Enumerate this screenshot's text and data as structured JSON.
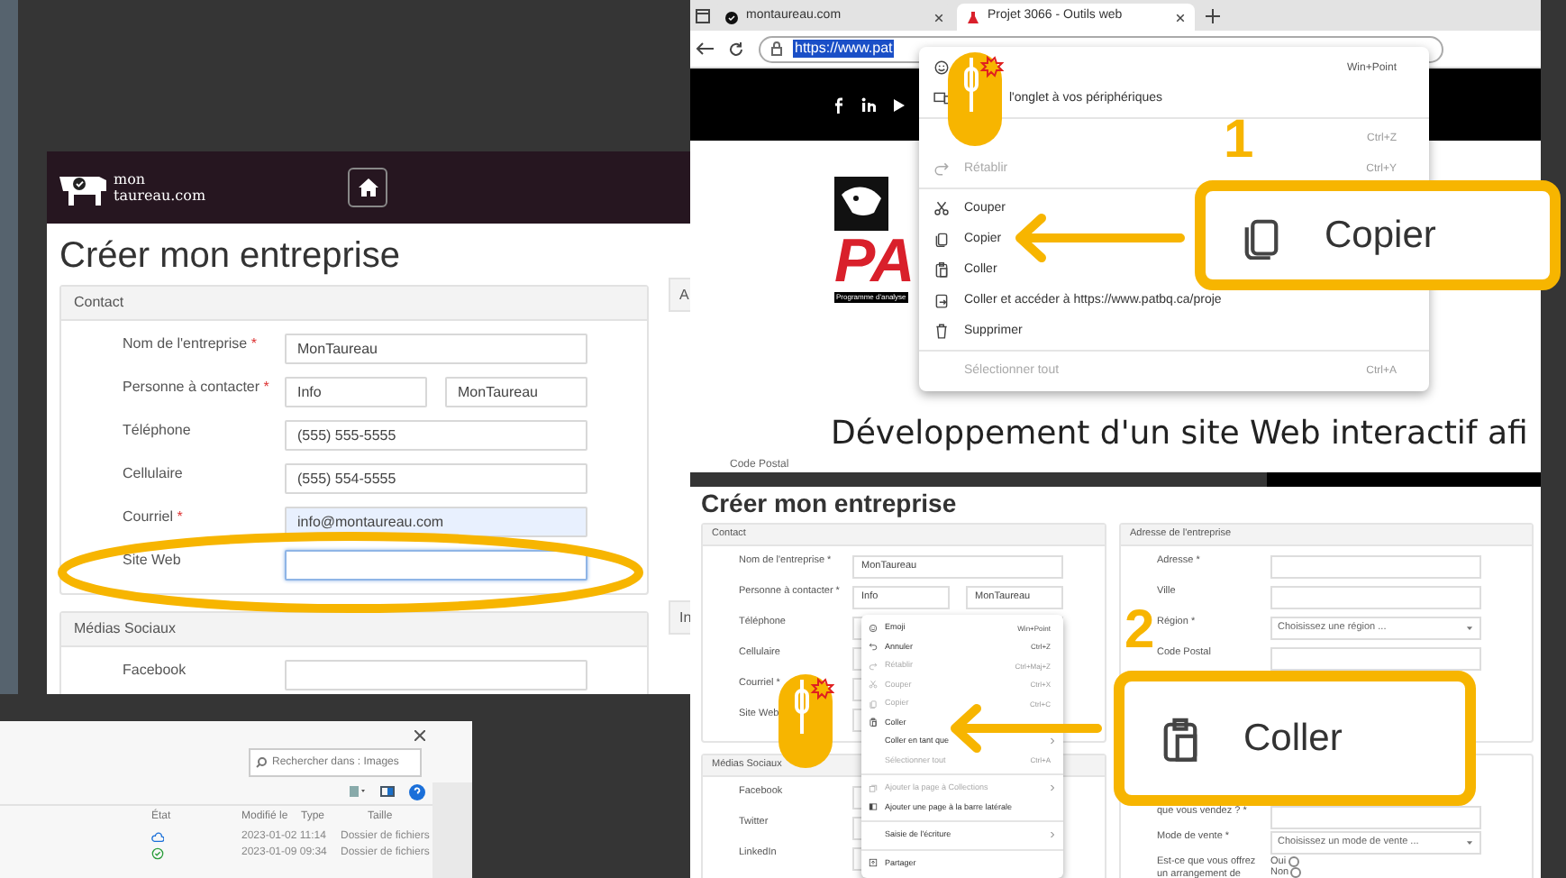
{
  "form_window": {
    "logo_text": [
      "mon",
      "taureau.com"
    ],
    "heading": "Créer mon entreprise",
    "sections": [
      {
        "title": "Contact",
        "fields": [
          {
            "label": "Nom de l'entreprise",
            "required_mark": "*",
            "values": [
              "MonTaureau"
            ],
            "autofilled": false,
            "focused": false
          },
          {
            "label": "Personne à contacter",
            "required_mark": "*",
            "values": [
              "Info",
              "MonTaureau"
            ],
            "autofilled": false,
            "focused": false
          },
          {
            "label": "Téléphone",
            "values": [
              "(555) 555-5555"
            ],
            "autofilled": false,
            "focused": false
          },
          {
            "label": "Cellulaire",
            "values": [
              "(555) 554-5555"
            ],
            "autofilled": false,
            "focused": false
          },
          {
            "label": "Courriel",
            "required_mark": "*",
            "values": [
              "info@montaureau.com"
            ],
            "autofilled": true,
            "focused": false
          },
          {
            "label": "Site Web",
            "autofilled": false,
            "focused": true
          }
        ]
      },
      {
        "title": "Médias Sociaux",
        "fields": [
          {
            "label": "Facebook",
            "autofilled": false,
            "focused": false
          }
        ]
      }
    ],
    "side_sections": [
      {
        "title": "A"
      },
      {
        "title": "In"
      }
    ]
  },
  "browser_window": {
    "tabs": [
      {
        "title": "montaureau.com",
        "selected": false
      },
      {
        "title": "Projet 3066 - Outils web",
        "selected": true
      }
    ],
    "url_selected": "https://www.pat",
    "logo_letters": "PA",
    "logo_caption": "Programme d'analyse",
    "page_heading": "Développement d'un site Web interactif afi",
    "background_label": "Code Postal",
    "context_menu": [
      {
        "kind": "emoji",
        "shortcut": "Win+Point",
        "disabled": false
      },
      {
        "kind": "devices",
        "label": "l'onglet à vos périphériques",
        "disabled": false
      },
      {
        "kind": "separator"
      },
      {
        "kind": "plain",
        "shortcut": "Ctrl+Z",
        "disabled": true
      },
      {
        "kind": "redo",
        "label": "Rétablir",
        "shortcut": "Ctrl+Y",
        "disabled": true
      },
      {
        "kind": "separator"
      },
      {
        "kind": "cut",
        "label": "Couper",
        "disabled": false
      },
      {
        "kind": "copy",
        "label": "Copier",
        "disabled": false
      },
      {
        "kind": "paste",
        "label": "Coller",
        "disabled": false
      },
      {
        "kind": "paste-go",
        "label": "Coller et accéder à https://www.patbq.ca/proje",
        "disabled": false
      },
      {
        "kind": "trash",
        "label": "Supprimer",
        "disabled": false
      },
      {
        "kind": "separator"
      },
      {
        "kind": "plain",
        "label": "Sélectionner tout",
        "shortcut": "Ctrl+A",
        "disabled": true
      }
    ]
  },
  "form_window_2": {
    "heading": "Créer mon entreprise",
    "left_sections": [
      {
        "title": "Contact",
        "fields": [
          {
            "label": "Nom de l'entreprise *",
            "values": [
              "MonTaureau"
            ]
          },
          {
            "label": "Personne à contacter *",
            "values": [
              "Info",
              "MonTaureau"
            ]
          },
          {
            "label": "Téléphone"
          },
          {
            "label": "Cellulaire"
          },
          {
            "label": "Courriel *"
          },
          {
            "label": "Site Web"
          }
        ]
      },
      {
        "title": "Médias Sociaux",
        "fields": [
          {
            "label": "Facebook"
          },
          {
            "label": "Twitter"
          },
          {
            "label": "LinkedIn"
          }
        ]
      }
    ],
    "right_sections": [
      {
        "title": "Adresse de l'entreprise",
        "fields": [
          {
            "label": "Adresse *"
          },
          {
            "label": "Ville"
          },
          {
            "label": "Région *",
            "kind": "select",
            "placeholder": "Choisissez une région ..."
          },
          {
            "label": "Code Postal"
          }
        ]
      },
      {
        "fields": [
          {
            "label": "que vous vendez ? *"
          },
          {
            "label": "Mode de vente *",
            "kind": "select",
            "placeholder": "Choisissez un mode de vente ..."
          },
          {
            "label": "Est-ce que vous offrez un arrangement de",
            "kind": "radio",
            "options": [
              {
                "label": "Oui",
                "selected": false
              },
              {
                "label": "Non",
                "selected": false
              }
            ]
          }
        ]
      }
    ],
    "context_menu": [
      {
        "kind": "emoji",
        "label": "Emoji",
        "shortcut": "Win+Point",
        "disabled": false
      },
      {
        "kind": "undo",
        "label": "Annuler",
        "shortcut": "Ctrl+Z",
        "disabled": false
      },
      {
        "kind": "redo",
        "label": "Rétablir",
        "shortcut": "Ctrl+Maj+Z",
        "disabled": true
      },
      {
        "kind": "cut",
        "label": "Couper",
        "shortcut": "Ctrl+X",
        "disabled": true
      },
      {
        "kind": "copy",
        "label": "Copier",
        "shortcut": "Ctrl+C",
        "disabled": true
      },
      {
        "kind": "paste",
        "label": "Coller",
        "disabled": false
      },
      {
        "kind": "plain",
        "label": "Coller en tant que",
        "submenu": true,
        "disabled": false
      },
      {
        "kind": "plain",
        "label": "Sélectionner tout",
        "shortcut": "Ctrl+A",
        "disabled": true
      },
      {
        "kind": "separator"
      },
      {
        "kind": "collections",
        "label": "Ajouter la page à Collections",
        "submenu": true,
        "disabled": true
      },
      {
        "kind": "sidebar",
        "label": "Ajouter une page à la barre latérale",
        "disabled": false
      },
      {
        "kind": "separator"
      },
      {
        "kind": "plain",
        "label": "Saisie de l'écriture",
        "submenu": true,
        "disabled": false
      },
      {
        "kind": "separator"
      },
      {
        "kind": "share",
        "label": "Partager",
        "disabled": false
      }
    ]
  },
  "file_explorer": {
    "search_placeholder": "Rechercher dans : Images",
    "columns": [
      "État",
      "Modifié le",
      "Type",
      "Taille"
    ],
    "rows": [
      {
        "kind": "cloud",
        "modified": "2023-01-02 11:14",
        "type": "Dossier de fichiers"
      },
      {
        "kind": "synced",
        "modified": "2023-01-09 09:34",
        "type": "Dossier de fichiers"
      }
    ]
  },
  "callouts": [
    {
      "number": "1",
      "label": "Copier",
      "kind": "copy"
    },
    {
      "number": "2",
      "label": "Coller",
      "kind": "paste"
    }
  ]
}
